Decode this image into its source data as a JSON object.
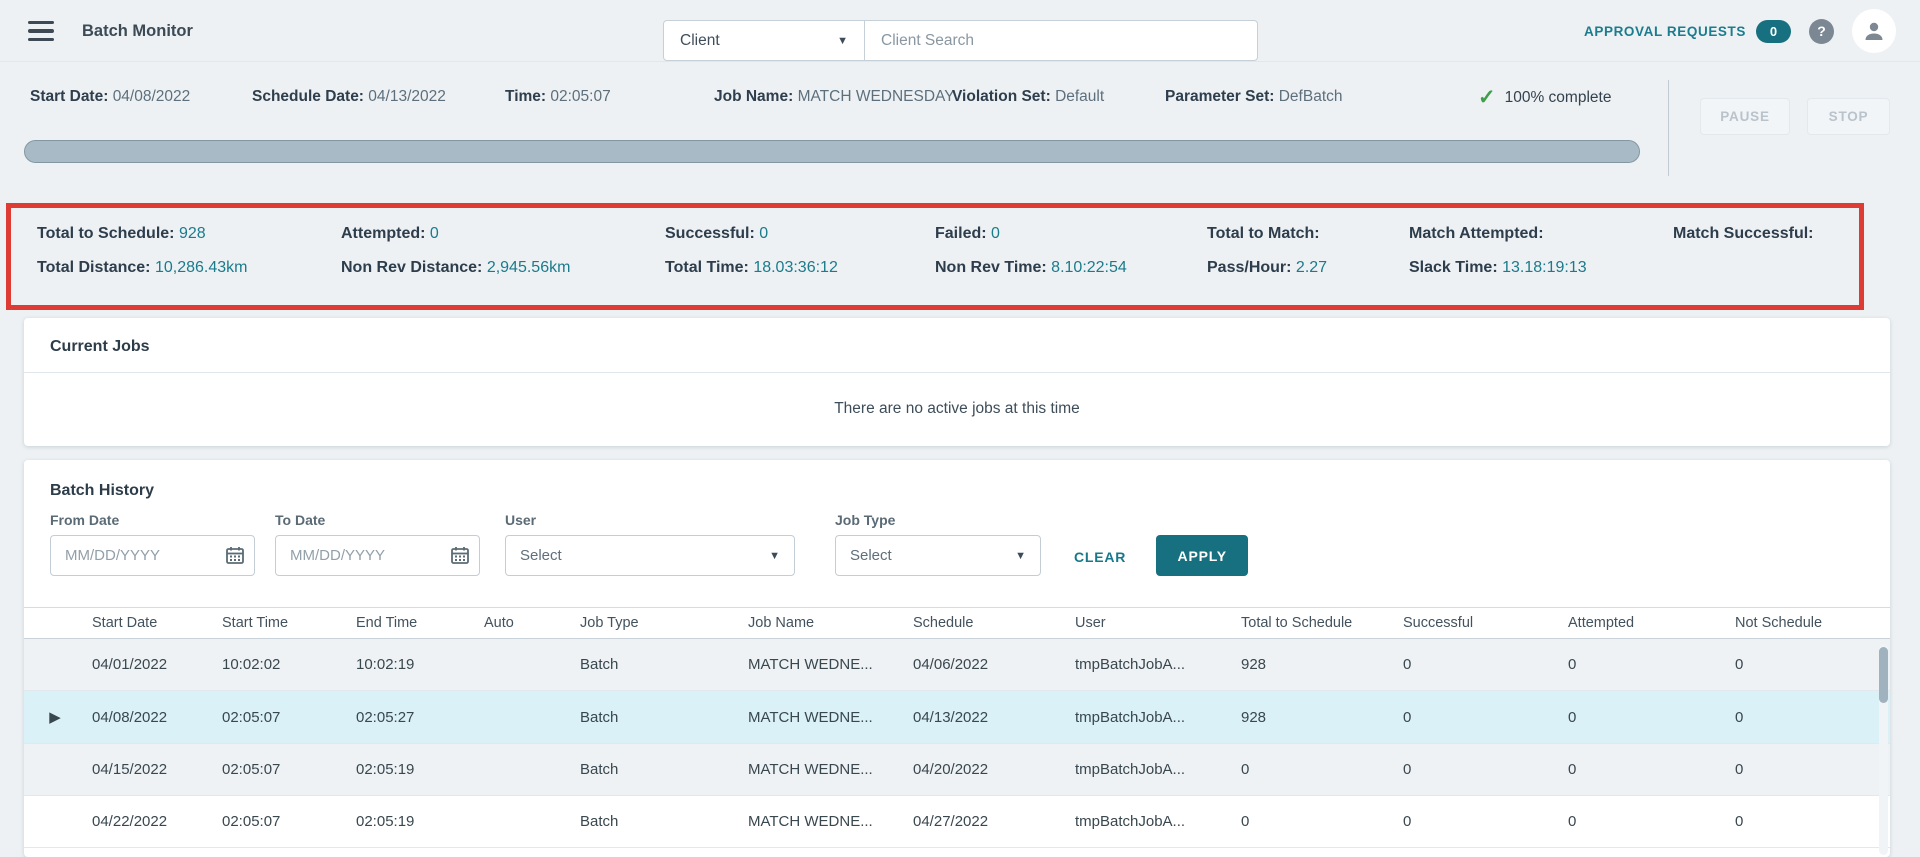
{
  "app": {
    "title": "Batch Monitor"
  },
  "topbar": {
    "client_selector": {
      "value": "Client"
    },
    "client_search": {
      "placeholder": "Client Search"
    },
    "approval_requests": {
      "label": "APPROVAL REQUESTS",
      "count": "0"
    },
    "help_glyph": "?"
  },
  "icons": {
    "dropdown_caret": "▼",
    "checkmark": "✓",
    "row_expand": "▶"
  },
  "colors": {
    "accent_teal": "#1b7c8d",
    "apply_button": "#16707f",
    "highlight_red": "#dd3b33",
    "progress_fill": "#a8bac5",
    "check_green": "#3da048",
    "selected_row": "#daf1f7"
  },
  "job_status": {
    "fields": [
      {
        "label": "Start Date:",
        "value": "04/08/2022"
      },
      {
        "label": "Schedule Date:",
        "value": "04/13/2022"
      },
      {
        "label": "Time:",
        "value": "02:05:07"
      },
      {
        "label": "Job Name:",
        "value": "MATCH WEDNESDAY"
      },
      {
        "label": "Violation Set:",
        "value": "Default"
      },
      {
        "label": "Parameter Set:",
        "value": "DefBatch"
      }
    ],
    "complete_label": "100% complete",
    "progress_percent": 100,
    "pause_label": "PAUSE",
    "stop_label": "STOP"
  },
  "stats": {
    "row1": [
      {
        "label": "Total to Schedule:",
        "value": "928"
      },
      {
        "label": "Attempted:",
        "value": "0"
      },
      {
        "label": "Successful:",
        "value": "0"
      },
      {
        "label": "Failed:",
        "value": "0"
      },
      {
        "label": "Total to Match:",
        "value": ""
      },
      {
        "label": "Match Attempted:",
        "value": ""
      },
      {
        "label": "Match Successful:",
        "value": ""
      }
    ],
    "row2": [
      {
        "label": "Total Distance:",
        "value": "10,286.43km"
      },
      {
        "label": "Non Rev Distance:",
        "value": "2,945.56km"
      },
      {
        "label": "Total Time:",
        "value": "18.03:36:12"
      },
      {
        "label": "Non Rev Time:",
        "value": "8.10:22:54"
      },
      {
        "label": "Pass/Hour:",
        "value": "2.27"
      },
      {
        "label": "Slack Time:",
        "value": "13.18:19:13"
      }
    ]
  },
  "current_jobs": {
    "title": "Current Jobs",
    "empty_message": "There are no active jobs at this time"
  },
  "batch_history": {
    "title": "Batch History",
    "filters": {
      "from_date": {
        "label": "From Date",
        "placeholder": "MM/DD/YYYY"
      },
      "to_date": {
        "label": "To Date",
        "placeholder": "MM/DD/YYYY"
      },
      "user": {
        "label": "User",
        "value": "Select"
      },
      "job_type": {
        "label": "Job Type",
        "value": "Select"
      },
      "clear_label": "CLEAR",
      "apply_label": "APPLY"
    },
    "table": {
      "columns": [
        "Start Date",
        "Start Time",
        "End Time",
        "Auto",
        "Job Type",
        "Job Name",
        "Schedule",
        "User",
        "Total to Schedule",
        "Successful",
        "Attempted",
        "Not Schedule"
      ],
      "rows": [
        {
          "selected": false,
          "cells": [
            "04/01/2022",
            "10:02:02",
            "10:02:19",
            "",
            "Batch",
            "MATCH WEDNE...",
            "04/06/2022",
            "tmpBatchJobA...",
            "928",
            "0",
            "0",
            "0"
          ]
        },
        {
          "selected": true,
          "cells": [
            "04/08/2022",
            "02:05:07",
            "02:05:27",
            "",
            "Batch",
            "MATCH WEDNE...",
            "04/13/2022",
            "tmpBatchJobA...",
            "928",
            "0",
            "0",
            "0"
          ]
        },
        {
          "selected": false,
          "cells": [
            "04/15/2022",
            "02:05:07",
            "02:05:19",
            "",
            "Batch",
            "MATCH WEDNE...",
            "04/20/2022",
            "tmpBatchJobA...",
            "0",
            "0",
            "0",
            "0"
          ]
        },
        {
          "selected": false,
          "cells": [
            "04/22/2022",
            "02:05:07",
            "02:05:19",
            "",
            "Batch",
            "MATCH WEDNE...",
            "04/27/2022",
            "tmpBatchJobA...",
            "0",
            "0",
            "0",
            "0"
          ]
        }
      ]
    }
  }
}
